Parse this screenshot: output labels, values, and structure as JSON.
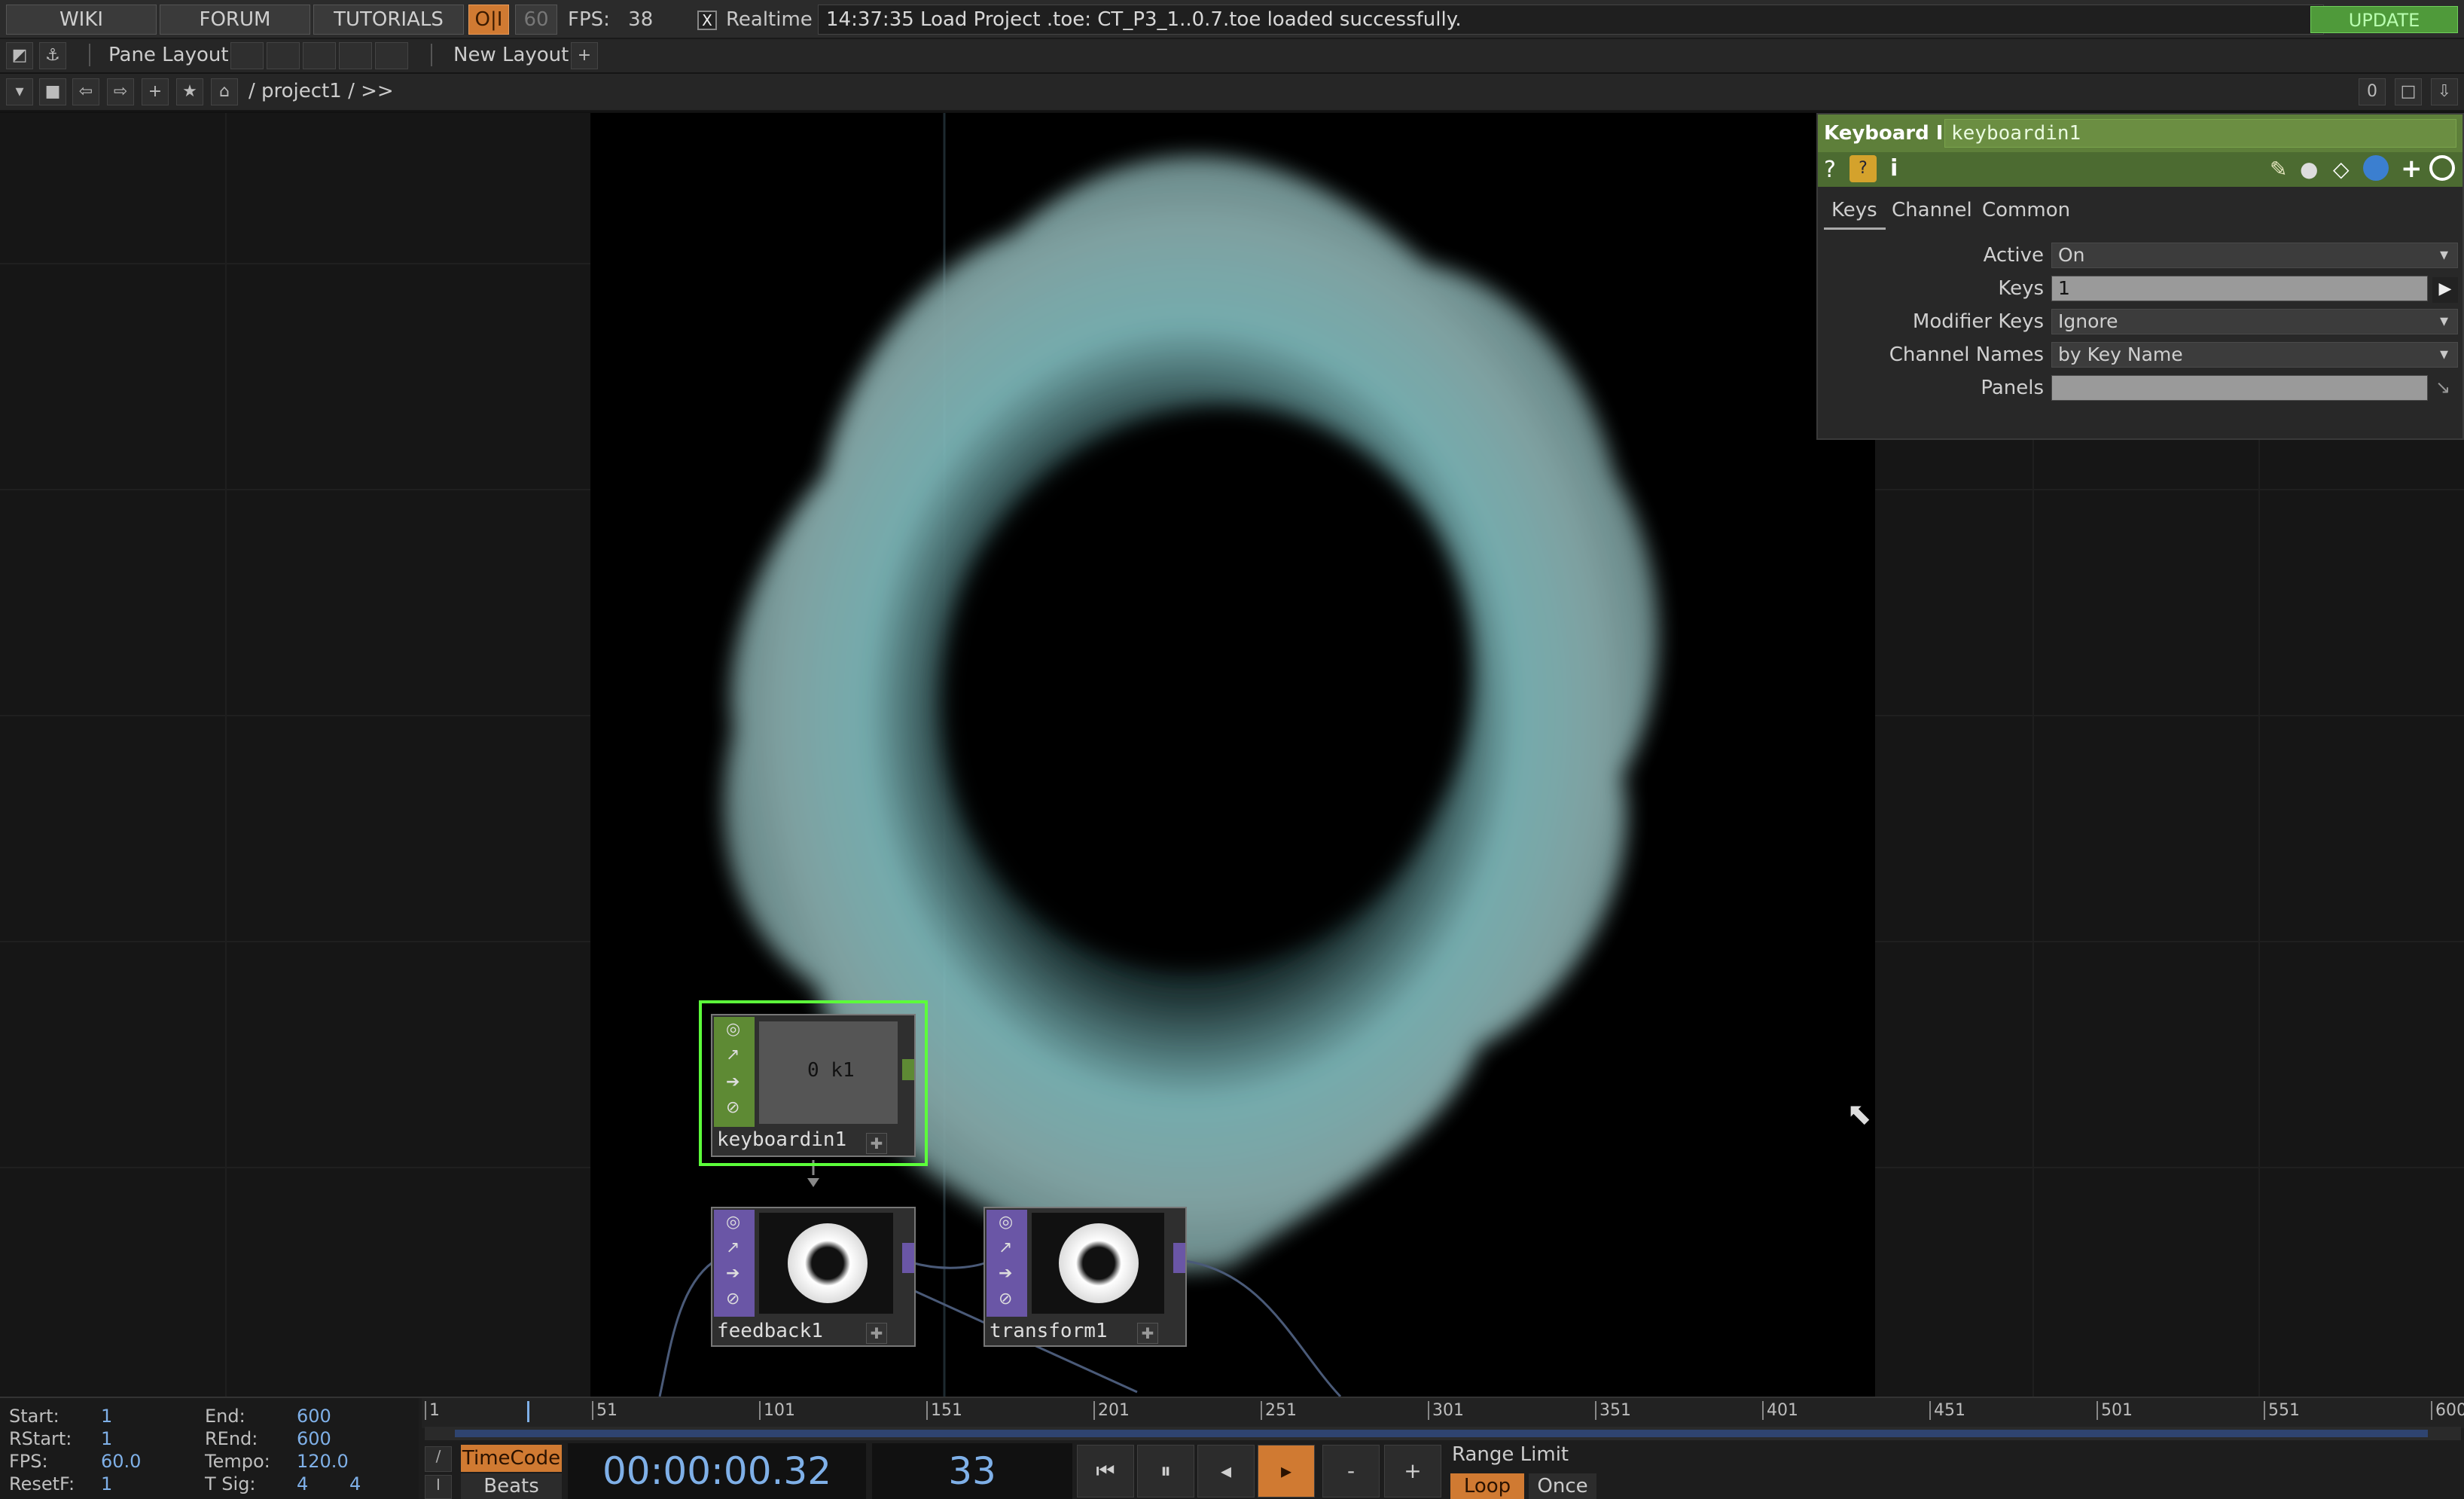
{
  "topbar": {
    "wiki": "WIKI",
    "forum": "FORUM",
    "tutorials": "TUTORIALS",
    "oi": "O|I",
    "fps_cap": "60",
    "fps_label": "FPS:",
    "fps_value": "38",
    "realtime_check": "X",
    "realtime": "Realtime",
    "status": "14:37:35 Load Project .toe: CT_P3_1..0.7.toe loaded successfully.",
    "update": "UPDATE"
  },
  "bar2": {
    "pane_layout": "Pane Layout",
    "new_layout": "New Layout",
    "add": "+"
  },
  "bar3": {
    "path": "/ project1 / >>",
    "right_value": "0"
  },
  "params": {
    "op_type": "Keyboard In",
    "op_name": "keyboardin1",
    "tabs": [
      "Keys",
      "Channel",
      "Common"
    ],
    "rows": [
      {
        "label": "Active",
        "value": "On"
      },
      {
        "label": "Keys",
        "value": "1"
      },
      {
        "label": "Modifier Keys",
        "value": "Ignore"
      },
      {
        "label": "Channel Names",
        "value": "by Key Name"
      },
      {
        "label": "Panels",
        "value": ""
      }
    ]
  },
  "nodes": {
    "keyboard": {
      "name": "keyboardin1",
      "display": "0 k1"
    },
    "feedback": {
      "name": "feedback1"
    },
    "transform": {
      "name": "transform1"
    }
  },
  "timeline": {
    "start_label": "Start:",
    "start": "1",
    "end_label": "End:",
    "end": "600",
    "rstart_label": "RStart:",
    "rstart": "1",
    "rend_label": "REnd:",
    "rend": "600",
    "fps_label": "FPS:",
    "fps": "60.0",
    "tempo_label": "Tempo:",
    "tempo": "120.0",
    "resetf_label": "ResetF:",
    "resetf": "1",
    "tsig_label": "T Sig:",
    "tsig_a": "4",
    "tsig_b": "4",
    "ticks": [
      "1",
      "51",
      "101",
      "151",
      "201",
      "251",
      "301",
      "351",
      "401",
      "451",
      "501",
      "551",
      "600"
    ],
    "timecode_btn": "TimeCode",
    "beats_btn": "Beats",
    "timecode": "00:00:00.32",
    "frame": "33",
    "range_limit": "Range Limit",
    "loop": "Loop",
    "once": "Once",
    "minus": "-",
    "plus": "+"
  },
  "colors": {
    "accent_orange": "#d07a32",
    "param_header_green": "#5e7f3a",
    "node_select_green": "#5cff3a",
    "ring": "#7fb7b8"
  }
}
